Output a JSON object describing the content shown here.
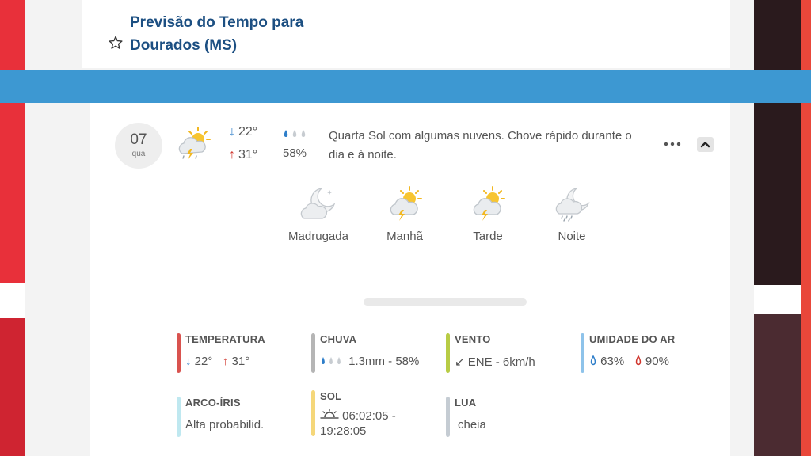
{
  "header": {
    "title_line1": "Previsão do Tempo para",
    "title_line2": "Dourados (MS)"
  },
  "day": {
    "date_number": "07",
    "weekday": "qua",
    "temp_min": "22°",
    "temp_max": "31°",
    "rain_chance": "58%",
    "description": "Quarta Sol com algumas nuvens. Chove rápido durante o dia e à noite."
  },
  "periods": [
    {
      "label": "Madrugada",
      "icon": "moon-cloud-icon"
    },
    {
      "label": "Manhã",
      "icon": "sun-cloud-storm-icon"
    },
    {
      "label": "Tarde",
      "icon": "sun-cloud-storm-icon"
    },
    {
      "label": "Noite",
      "icon": "moon-cloud-rain-icon"
    }
  ],
  "stats": {
    "temperatura": {
      "title": "TEMPERATURA",
      "min": "22°",
      "max": "31°",
      "color": "#d9534f"
    },
    "chuva": {
      "title": "CHUVA",
      "value": "1.3mm - 58%",
      "color": "#b5b5b5"
    },
    "vento": {
      "title": "VENTO",
      "value": "ENE - 6km/h",
      "color": "#b8cc45"
    },
    "umidade": {
      "title": "UMIDADE DO AR",
      "min": "63%",
      "max": "90%",
      "color": "#8ec3ea"
    },
    "arco_iris": {
      "title": "ARCO-ÍRIS",
      "value": "Alta probabilid.",
      "color": "#bfe8f0"
    },
    "sol": {
      "title": "SOL",
      "value_line1": "06:02:05 -",
      "value_line2": "19:28:05",
      "color": "#f5d77a"
    },
    "lua": {
      "title": "LUA",
      "value": "cheia",
      "color": "#c5ccd3"
    }
  },
  "icons": {
    "main": "sun-cloud-storm-icon",
    "star": "star-outline-icon",
    "more": "more-dots-icon",
    "collapse": "chevron-up-icon"
  }
}
